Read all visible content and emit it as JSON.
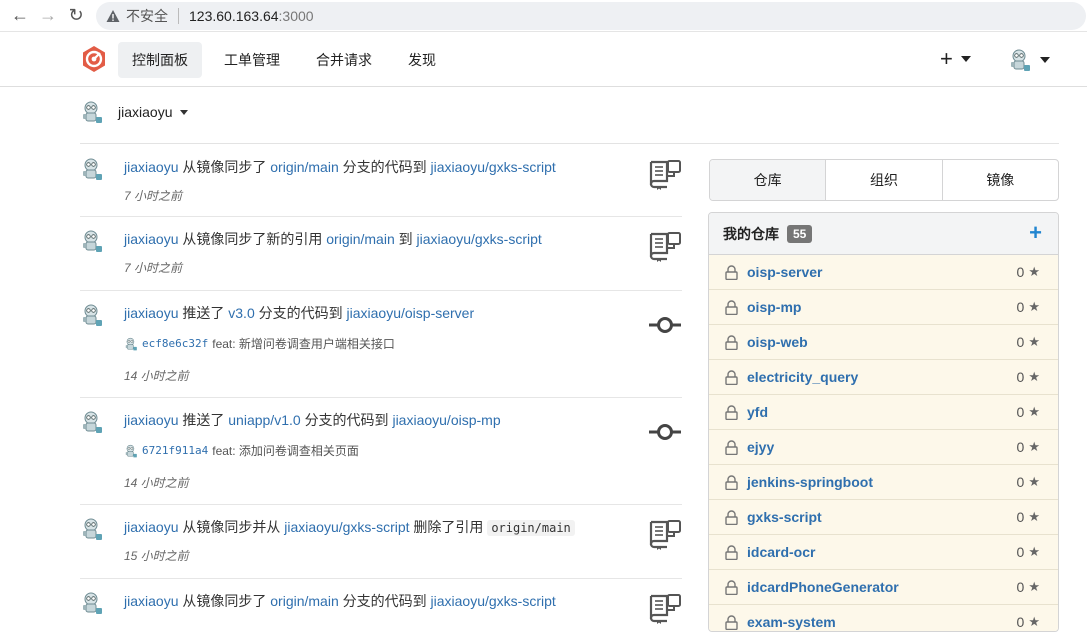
{
  "browser": {
    "insecure_label": "不安全",
    "host": "123.60.163.64",
    "port": ":3000"
  },
  "menu": {
    "items": [
      {
        "label": "控制面板"
      },
      {
        "label": "工单管理"
      },
      {
        "label": "合并请求"
      },
      {
        "label": "发现"
      }
    ],
    "plus_label": "+"
  },
  "context": {
    "user": "jiaxiaoyu"
  },
  "feed": [
    {
      "user": "jiaxiaoyu",
      "action": "从镜像同步了",
      "ref": "origin/main",
      "mid": "分支的代码到",
      "repo": "jiaxiaoyu/gxks-script",
      "time": "7 小时之前"
    },
    {
      "user": "jiaxiaoyu",
      "action": "从镜像同步了新的引用",
      "ref": "origin/main",
      "mid": "到",
      "repo": "jiaxiaoyu/gxks-script",
      "time": "7 小时之前"
    },
    {
      "user": "jiaxiaoyu",
      "action": "推送了",
      "ref": "v3.0",
      "mid": "分支的代码到",
      "repo": "jiaxiaoyu/oisp-server",
      "sha": "ecf8e6c32f",
      "msg": "feat: 新增问卷调查用户端相关接口",
      "time": "14 小时之前"
    },
    {
      "user": "jiaxiaoyu",
      "action": "推送了",
      "ref": "uniapp/v1.0",
      "mid": "分支的代码到",
      "repo": "jiaxiaoyu/oisp-mp",
      "sha": "6721f911a4",
      "msg": "feat: 添加问卷调查相关页面",
      "time": "14 小时之前"
    },
    {
      "user": "jiaxiaoyu",
      "action": "从镜像同步并从",
      "repo": "jiaxiaoyu/gxks-script",
      "mid": "删除了引用",
      "code": "origin/main",
      "time": "15 小时之前"
    },
    {
      "user": "jiaxiaoyu",
      "action": "从镜像同步了",
      "ref": "origin/main",
      "mid": "分支的代码到",
      "repo": "jiaxiaoyu/gxks-script"
    }
  ],
  "tabs": [
    {
      "label": "仓库"
    },
    {
      "label": "组织"
    },
    {
      "label": "镜像"
    }
  ],
  "repos": {
    "title": "我的仓库",
    "count": "55",
    "add_label": "+",
    "items": [
      {
        "name": "oisp-server",
        "stars": "0"
      },
      {
        "name": "oisp-mp",
        "stars": "0"
      },
      {
        "name": "oisp-web",
        "stars": "0"
      },
      {
        "name": "electricity_query",
        "stars": "0"
      },
      {
        "name": "yfd",
        "stars": "0"
      },
      {
        "name": "ejyy",
        "stars": "0"
      },
      {
        "name": "jenkins-springboot",
        "stars": "0"
      },
      {
        "name": "gxks-script",
        "stars": "0"
      },
      {
        "name": "idcard-ocr",
        "stars": "0"
      },
      {
        "name": "idcardPhoneGenerator",
        "stars": "0"
      },
      {
        "name": "exam-system",
        "stars": "0"
      }
    ]
  }
}
